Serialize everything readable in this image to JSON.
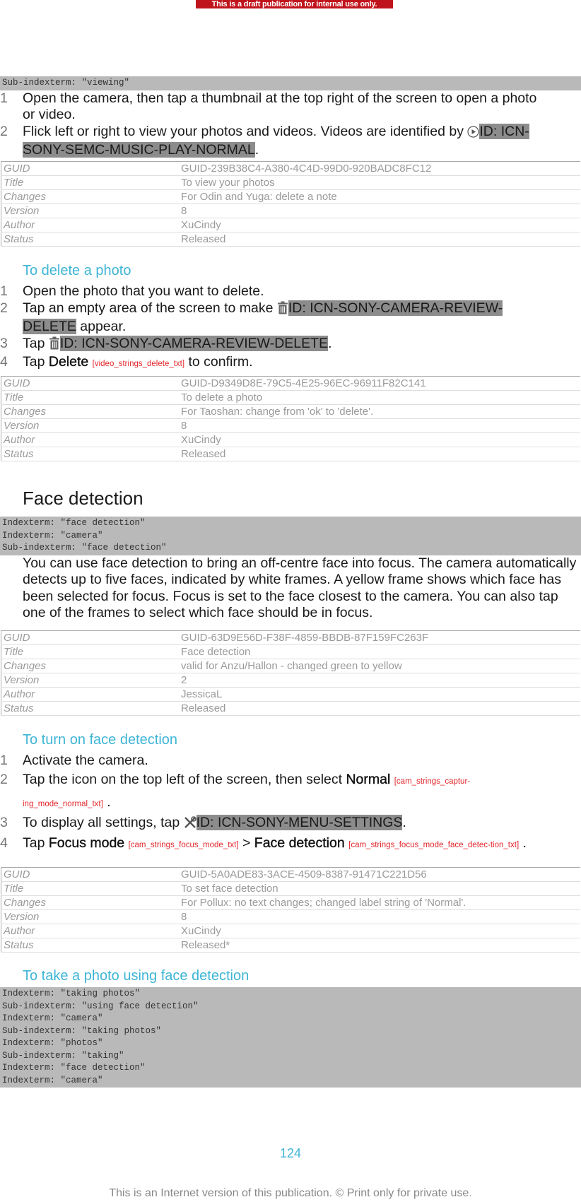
{
  "banner": "This is a draft publication for internal use only.",
  "section1": {
    "index_terms": [
      "Sub-indexterm: \"viewing\""
    ],
    "steps": [
      {
        "num": "1",
        "text": "Open the camera, then tap a thumbnail at the top right of the screen to open a photo or video."
      },
      {
        "num": "2",
        "text_before": "Flick left or right to view your photos and videos. Videos are identified by ",
        "icon": "play-circle-icon",
        "highlight": "ID: ICN-SONY-SEMC-MUSIC-PLAY-NORMAL",
        "text_after": "."
      }
    ],
    "meta": [
      {
        "key": "GUID",
        "value": "GUID-239B38C4-A380-4C4D-99D0-920BADC8FC12"
      },
      {
        "key": "Title",
        "value": "To view your photos"
      },
      {
        "key": "Changes",
        "value": "For Odin and Yuga: delete a note"
      },
      {
        "key": "Version",
        "value": "8"
      },
      {
        "key": "Author",
        "value": "XuCindy"
      },
      {
        "key": "Status",
        "value": "Released"
      }
    ]
  },
  "section2": {
    "title": "To delete a photo",
    "steps": [
      {
        "num": "1",
        "text": "Open the photo that you want to delete."
      },
      {
        "num": "2",
        "text_before": "Tap an empty area of the screen to make ",
        "icon": "trash-icon",
        "highlight": "ID: ICN-SONY-CAMERA-REVIEW-DELETE",
        "text_after": " appear."
      },
      {
        "num": "3",
        "text_before": "Tap ",
        "icon": "trash-icon",
        "highlight": "ID: ICN-SONY-CAMERA-REVIEW-DELETE",
        "text_after": "."
      },
      {
        "num": "4",
        "text_before": "Tap ",
        "bold": "Delete",
        "string_id": "[video_strings_delete_txt]",
        "text_after": " to confirm."
      }
    ],
    "meta": [
      {
        "key": "GUID",
        "value": "GUID-D9349D8E-79C5-4E25-96EC-96911F82C141"
      },
      {
        "key": "Title",
        "value": "To delete a photo"
      },
      {
        "key": "Changes",
        "value": "For Taoshan: change from 'ok' to 'delete'."
      },
      {
        "key": "Version",
        "value": "8"
      },
      {
        "key": "Author",
        "value": "XuCindy"
      },
      {
        "key": "Status",
        "value": "Released"
      }
    ]
  },
  "section3": {
    "title": "Face detection",
    "index_terms": [
      "Indexterm: \"face detection\"",
      "Indexterm: \"camera\"",
      "Sub-indexterm: \"face detection\""
    ],
    "paragraph": "You can use face detection to bring an off-centre face into focus. The camera automatically detects up to five faces, indicated by white frames. A yellow frame shows which face has been selected for focus. Focus is set to the face closest to the camera. You can also tap one of the frames to select which face should be in focus.",
    "meta": [
      {
        "key": "GUID",
        "value": "GUID-63D9E56D-F38F-4859-BBDB-87F159FC263F"
      },
      {
        "key": "Title",
        "value": "Face detection"
      },
      {
        "key": "Changes",
        "value": "valid for Anzu/Hallon - changed green to yellow"
      },
      {
        "key": "Version",
        "value": "2"
      },
      {
        "key": "Author",
        "value": "JessicaL"
      },
      {
        "key": "Status",
        "value": "Released"
      }
    ]
  },
  "section4": {
    "title": "To turn on face detection",
    "steps": [
      {
        "num": "1",
        "text": "Activate the camera."
      },
      {
        "num": "2",
        "text_before": "Tap the icon on the top left of the screen, then select ",
        "bold": "Normal",
        "string_id": "[cam_strings_captur-ing_mode_normal_txt]",
        "text_after": " ."
      },
      {
        "num": "3",
        "text_before": "To display all settings, tap ",
        "icon": "settings-tools-icon",
        "highlight": "ID: ICN-SONY-MENU-SETTINGS",
        "text_after": "."
      },
      {
        "num": "4",
        "text_before": "Tap ",
        "bold": "Focus mode",
        "string_id": "[cam_strings_focus_mode_txt]",
        "separator": " > ",
        "bold2": "Face detection",
        "string_id2": "[cam_strings_focus_mode_face_detec-tion_txt]",
        "text_after": " ."
      }
    ],
    "meta": [
      {
        "key": "GUID",
        "value": "GUID-5A0ADE83-3ACE-4509-8387-91471C221D56"
      },
      {
        "key": "Title",
        "value": "To set face detection"
      },
      {
        "key": "Changes",
        "value": "For Pollux: no text changes; changed label string of 'Normal'."
      },
      {
        "key": "Version",
        "value": "8"
      },
      {
        "key": "Author",
        "value": "XuCindy"
      },
      {
        "key": "Status",
        "value": "Released*"
      }
    ]
  },
  "section5": {
    "title": "To take a photo using face detection",
    "index_terms": [
      "Indexterm: \"taking photos\"",
      "Sub-indexterm: \"using face detection\"",
      "Indexterm: \"camera\"",
      "Sub-indexterm: \"taking photos\"",
      "Indexterm: \"photos\"",
      "Sub-indexterm: \"taking\"",
      "Indexterm: \"face detection\"",
      "Indexterm: \"camera\""
    ]
  },
  "page_number": "124",
  "footer": "This is an Internet version of this publication. © Print only for private use.",
  "colors": {
    "accent": "#3fb5d6",
    "banner": "#c0141c",
    "string_id": "#e3262b",
    "highlight": "#8c8c8c",
    "index_bg": "#b9b9b9"
  }
}
